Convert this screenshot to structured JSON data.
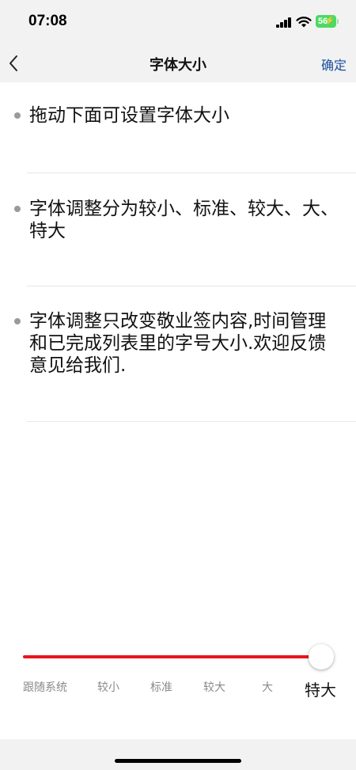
{
  "status_bar": {
    "time": "07:08",
    "battery": "56"
  },
  "nav": {
    "title": "字体大小",
    "confirm_label": "确定"
  },
  "tips": [
    "拖动下面可设置字体大小",
    "字体调整分为较小、标准、较大、大、特大",
    "字体调整只改变敬业签内容,时间管理和已完成列表里的字号大小.欢迎反馈意见给我们."
  ],
  "slider": {
    "options": [
      "跟随系统",
      "较小",
      "标准",
      "较大",
      "大",
      "特大"
    ],
    "selected": "特大",
    "selected_index": 5,
    "accent_color": "#e8151b"
  }
}
